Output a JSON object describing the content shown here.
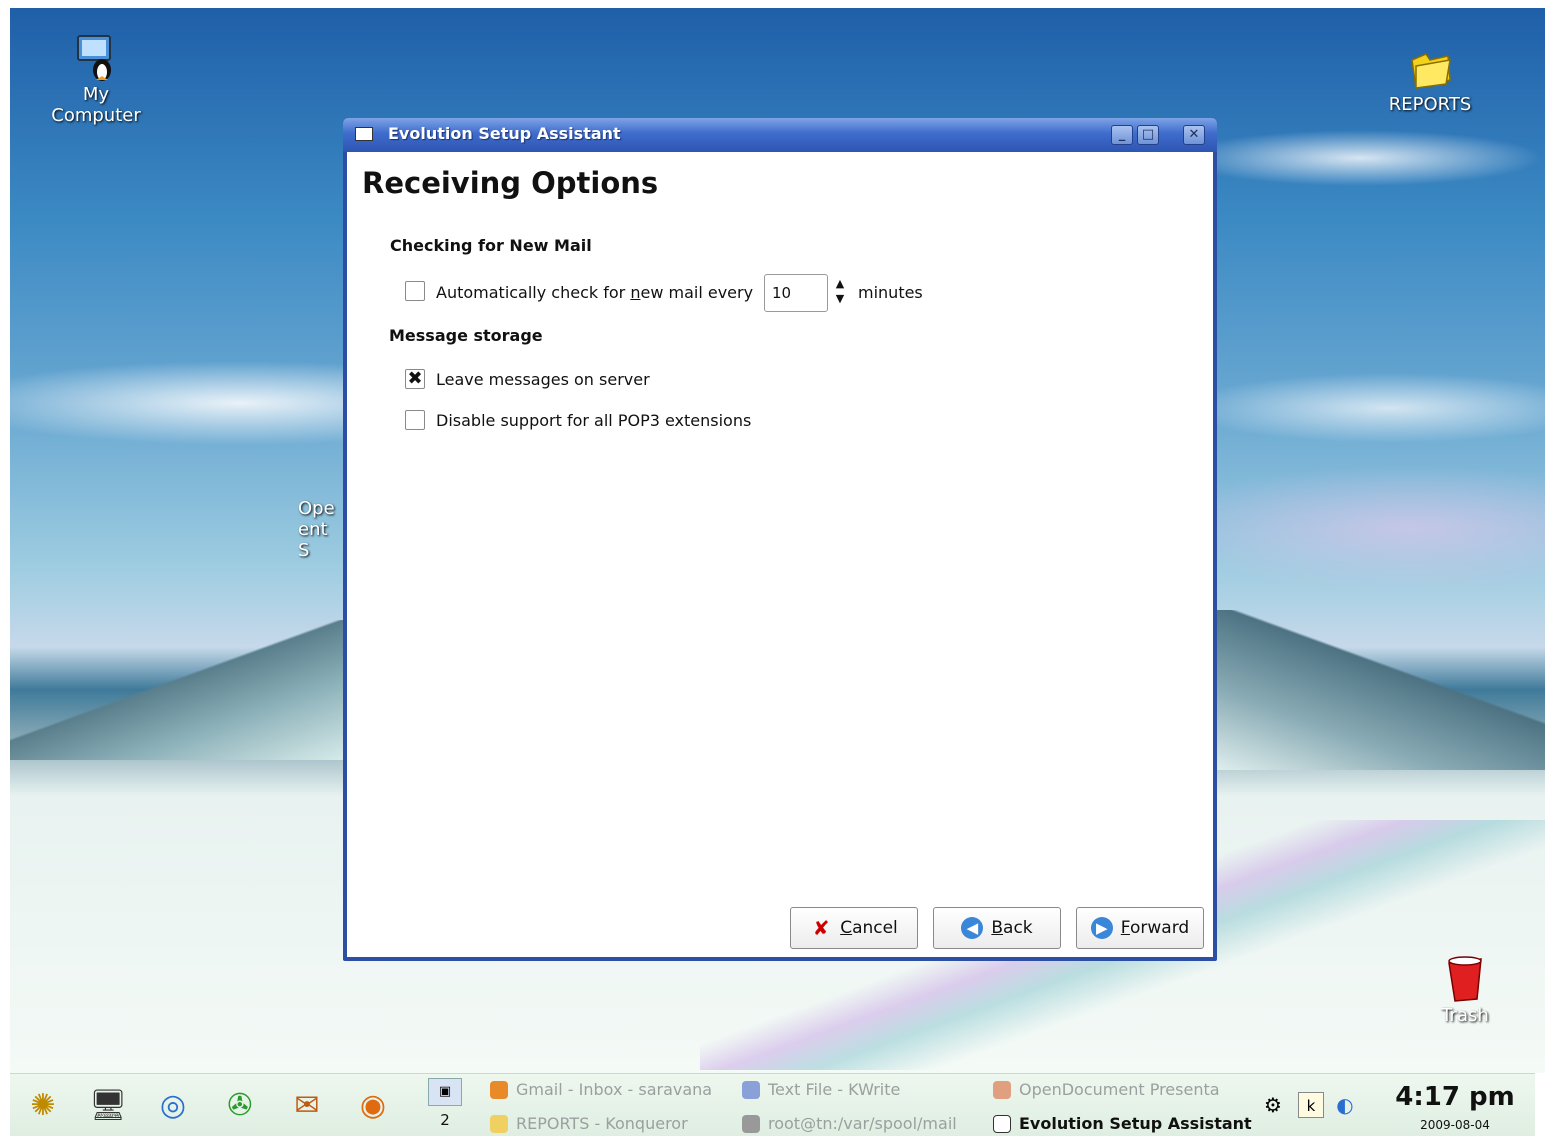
{
  "desktop": {
    "icons": {
      "my_computer": {
        "line1": "My",
        "line2": "Computer"
      },
      "reports": "REPORTS",
      "trash": "Trash",
      "partial_label": {
        "line1": "Ope",
        "line2": "ent S"
      }
    }
  },
  "window": {
    "title": "Evolution Setup Assistant",
    "controls": {
      "minimize": "_",
      "maximize": "□",
      "close": "✕"
    },
    "heading": "Receiving Options",
    "checking": {
      "section_title": "Checking for New Mail",
      "auto_check_label_pre": "Automatically check for ",
      "auto_check_label_mnemonic": "n",
      "auto_check_label_post": "ew mail every",
      "auto_check_checked": false,
      "interval_value": "10",
      "interval_unit": "minutes"
    },
    "storage": {
      "section_title": "Message storage",
      "leave_on_server_label": "Leave messages on server",
      "leave_on_server_checked": true,
      "disable_pop3_label": "Disable support for all POP3 extensions",
      "disable_pop3_checked": false,
      "check_mark": "✖"
    },
    "buttons": {
      "cancel": {
        "mnemonic": "C",
        "rest": "ancel",
        "icon": "✘"
      },
      "back": {
        "mnemonic": "B",
        "rest": "ack",
        "icon": "◀"
      },
      "forward": {
        "mnemonic": "F",
        "rest": "orward",
        "icon": "▶"
      }
    }
  },
  "taskbar": {
    "pager": {
      "desk1": "▣",
      "desk2": "2"
    },
    "tasks": [
      {
        "label": "Gmail - Inbox - saravana",
        "active": false
      },
      {
        "label": "Text File - KWrite",
        "active": false
      },
      {
        "label": "OpenDocument Presenta",
        "active": false
      },
      {
        "label": "REPORTS - Konqueror",
        "active": false
      },
      {
        "label": "root@tn:/var/spool/mail",
        "active": false
      },
      {
        "label": "Evolution Setup Assistant",
        "active": true
      }
    ],
    "clock": {
      "time": "4:17 pm",
      "date": "2009-08-04"
    }
  },
  "colors": {
    "titlebar": "#3f6ccd",
    "window_border": "#2c4fa3"
  }
}
